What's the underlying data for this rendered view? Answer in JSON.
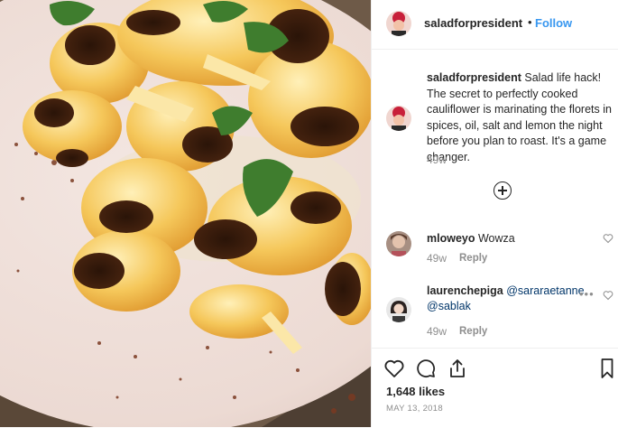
{
  "post": {
    "username": "saladforpresident",
    "follow_separator": "•",
    "follow_label": "Follow",
    "caption_username": "saladforpresident",
    "caption": "Salad life hack! The secret to perfectly cooked cauliflower is marinating the florets in spices, oil, salt and lemon the night before you plan to roast. It's a game changer.",
    "caption_time": "49w",
    "likes": "1,648 likes",
    "date": "MAY 13, 2018"
  },
  "comments": [
    {
      "username": "mloweyo",
      "text": "Wowza",
      "time": "49w",
      "reply_label": "Reply"
    },
    {
      "username": "laurenchepiga",
      "mention1": "@sararaetanne",
      "mention2": "@sablak",
      "time": "49w",
      "reply_label": "Reply",
      "more_label": "•••"
    }
  ],
  "icons": {
    "load_more": "plus-circle-icon",
    "like": "heart-icon",
    "comment": "comment-icon",
    "share": "share-icon",
    "save": "bookmark-icon"
  },
  "colors": {
    "link": "#3897f0",
    "muted": "#8e8e8e",
    "text": "#262626",
    "divider": "#efefef"
  }
}
